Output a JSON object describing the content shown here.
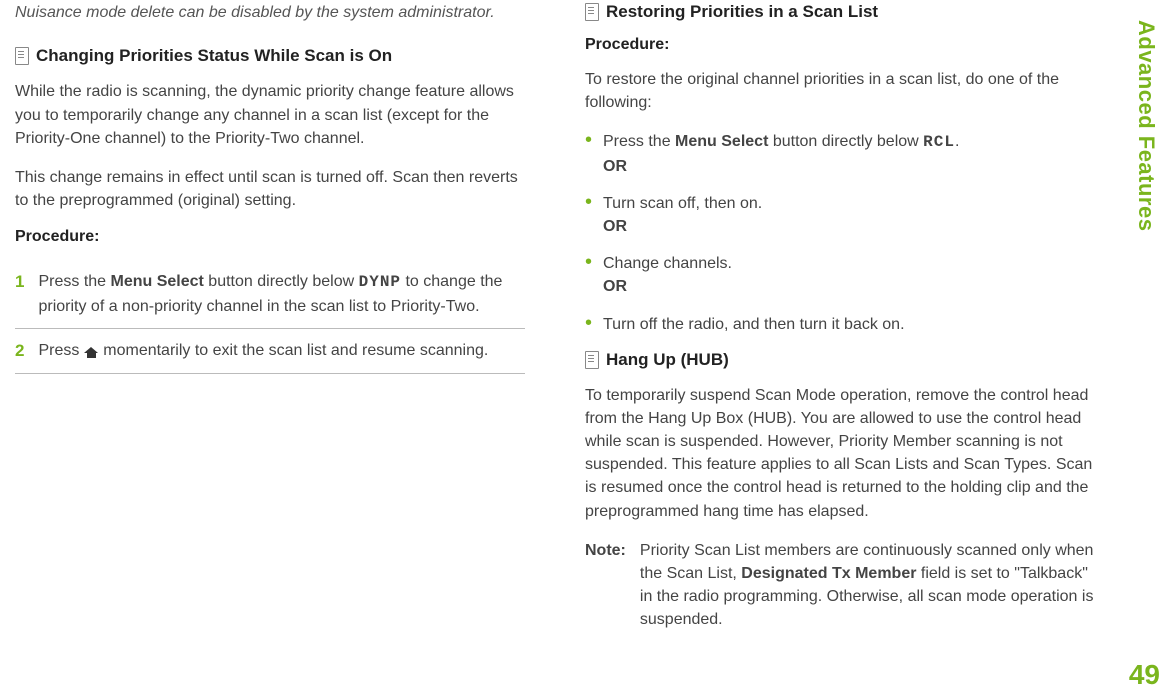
{
  "leftColumn": {
    "topNote": "Nuisance mode delete can be disabled by the system administrator.",
    "heading1": "Changing Priorities Status While Scan is On",
    "para1": "While the radio is scanning, the dynamic priority change feature allows you to temporarily change any channel in a scan list (except for the Priority-One channel) to the Priority-Two channel.",
    "para2": "This change remains in effect until scan is turned off. Scan then reverts to the preprogrammed (original) setting.",
    "procLabel": "Procedure:",
    "steps": [
      {
        "num": "1",
        "pre": "Press the ",
        "boldA": "Menu Select",
        "mid": " button directly below ",
        "code": "DYNP",
        "post": " to change the priority of a non-priority channel in the scan list to Priority-Two."
      },
      {
        "num": "2",
        "pre": "Press ",
        "post": " momentarily to exit the scan list and resume scanning."
      }
    ]
  },
  "rightColumn": {
    "heading1": "Restoring Priorities in a Scan List",
    "procLabel": "Procedure:",
    "intro": "To restore the original channel priorities in a scan list, do one of the following:",
    "bullets": [
      {
        "pre": "Press the ",
        "boldA": "Menu Select",
        "mid": " button directly below ",
        "code": "RCL",
        "post": ".",
        "or": "OR"
      },
      {
        "text": "Turn scan off, then on.",
        "or": "OR"
      },
      {
        "text": "Change channels.",
        "or": "OR"
      },
      {
        "text": "Turn off the radio, and then turn it back on."
      }
    ],
    "heading2": "Hang Up (HUB)",
    "para1": "To temporarily suspend Scan Mode operation, remove the control head from the Hang Up Box (HUB). You are allowed to use the control head while scan is suspended. However, Priority Member scanning is not suspended. This feature applies to all Scan Lists and Scan Types. Scan is resumed once the control head is returned to the holding clip and the preprogrammed hang time has elapsed.",
    "noteLabel": "Note:",
    "noteTextPre": "Priority Scan List members are continuously scanned only when the Scan List, ",
    "noteBold": "Designated Tx Member",
    "noteTextPost": " field is set to \"Talkback\" in the radio programming. Otherwise, all scan mode operation is suspended."
  },
  "sidebar": {
    "label": "Advanced Features",
    "pageNum": "49"
  }
}
